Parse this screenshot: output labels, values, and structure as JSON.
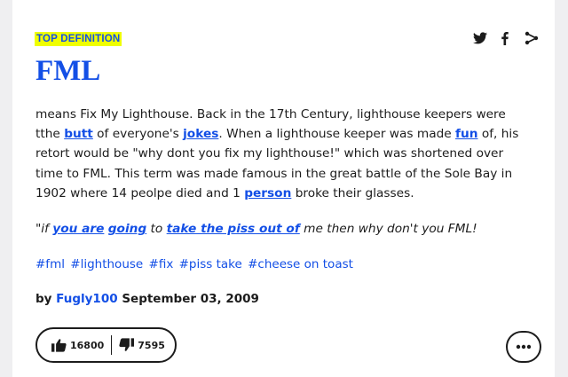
{
  "badge": "TOP DEFINITION",
  "word": "FML",
  "share": {
    "twitter": "twitter-icon",
    "facebook": "facebook-icon",
    "more": "share-icon"
  },
  "meaning": {
    "t1": "means Fix My Lighthouse. Back in the 17th Century, lighthouse keepers were tthe ",
    "link1": "butt",
    "t2": " of everyone's ",
    "link2": "jokes",
    "t3": ". When a lighthouse keeper was made ",
    "link3": "fun",
    "t4": " of, his retort would be \"why dont you fix my lighthouse!\" which was shortened over time to FML. This term was made famous in the great battle of the Sole Bay in 1902 where 14 peolpe died and 1 ",
    "link4": "person",
    "t5": " broke their glasses."
  },
  "example": {
    "t1": "\"if ",
    "link1": "you are",
    "t2": " ",
    "link2": "going",
    "t3": " to ",
    "link3": "take the piss out of",
    "t4": " me then why don't you FML!"
  },
  "tags": [
    "#fml",
    "#lighthouse",
    "#fix",
    "#piss take",
    "#cheese on toast"
  ],
  "contributor": {
    "by": "by",
    "author": "Fugly100",
    "date": "September 03, 2009"
  },
  "votes": {
    "up": "16800",
    "down": "7595"
  },
  "colors": {
    "accent": "#134fe6",
    "badge_bg": "#effe00",
    "text": "#1c1c1c",
    "page_bg": "#efeff1"
  }
}
